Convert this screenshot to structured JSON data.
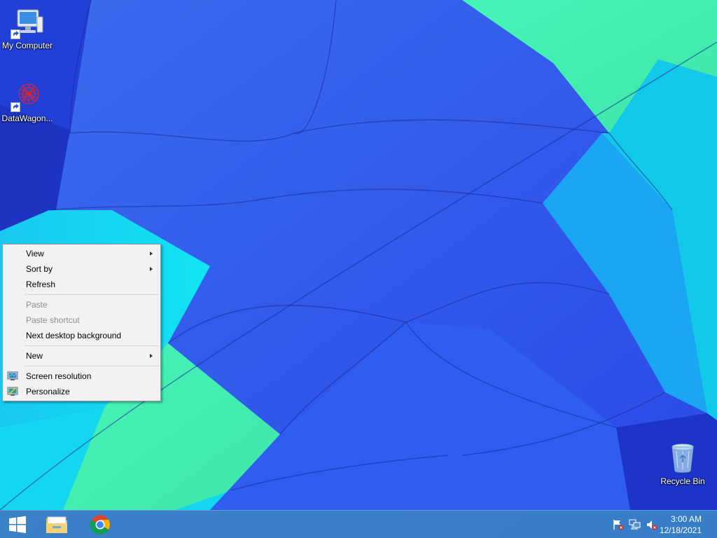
{
  "desktop": {
    "icons": [
      {
        "label": "My Computer",
        "icon": "computer-icon"
      },
      {
        "label": "DataWagon...",
        "icon": "datawagon-icon"
      },
      {
        "label": "Recycle Bin",
        "icon": "recycle-bin-icon"
      }
    ]
  },
  "context_menu": {
    "items": [
      {
        "label": "View",
        "has_submenu": true,
        "enabled": true
      },
      {
        "label": "Sort by",
        "has_submenu": true,
        "enabled": true
      },
      {
        "label": "Refresh",
        "enabled": true
      },
      {
        "label": "Paste",
        "enabled": false
      },
      {
        "label": "Paste shortcut",
        "enabled": false
      },
      {
        "label": "Next desktop background",
        "enabled": true
      },
      {
        "label": "New",
        "has_submenu": true,
        "enabled": true
      },
      {
        "label": "Screen resolution",
        "icon": "monitor-icon",
        "enabled": true
      },
      {
        "label": "Personalize",
        "icon": "personalize-icon",
        "enabled": true
      }
    ]
  },
  "taskbar": {
    "start_icon": "windows-logo-icon",
    "pinned": [
      {
        "name": "File Explorer",
        "icon": "folder-icon"
      },
      {
        "name": "Google Chrome",
        "icon": "chrome-icon"
      }
    ],
    "tray": [
      {
        "icon": "action-center-flag-icon"
      },
      {
        "icon": "network-icon"
      },
      {
        "icon": "volume-muted-icon"
      }
    ],
    "clock": {
      "time": "3:00 AM",
      "date": "12/18/2021"
    }
  },
  "colors": {
    "menu_bg": "#f2f2f2",
    "menu_disabled_text": "#8d8d8d",
    "taskbar_bg": "#3c8cbe"
  }
}
